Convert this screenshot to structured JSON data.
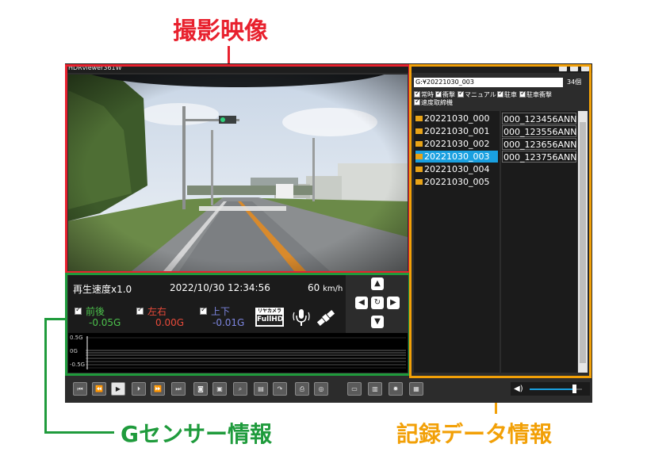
{
  "callouts": {
    "video": "撮影映像",
    "gsensor": "Gセンサー情報",
    "record": "記録データ情報"
  },
  "app": {
    "title": "HDRviewer361W"
  },
  "info": {
    "speed_label": "再生速度x1.0",
    "datetime": "2022/10/30 12:34:56",
    "speed_value": "60",
    "speed_unit": "km/h",
    "axes": [
      {
        "label": "前後",
        "value": "-0.05G",
        "color": "#4cc14c"
      },
      {
        "label": "左右",
        "value": "0.00G",
        "color": "#e84a3a"
      },
      {
        "label": "上下",
        "value": "-0.01G",
        "color": "#7d86e0"
      }
    ],
    "rear_camera_line1": "リヤカメラ",
    "rear_camera_line2": "FullHD"
  },
  "graph": {
    "top": "0.5G",
    "mid": "0G",
    "bottom": "-0.5G"
  },
  "right": {
    "path": "G:¥20221030_003",
    "count": "34個",
    "filters": [
      "常時",
      "衝撃",
      "マニュアル",
      "駐車",
      "駐車衝撃",
      "速度取締機"
    ],
    "folders": [
      "20221030_000",
      "20221030_001",
      "20221030_002",
      "20221030_003",
      "20221030_004",
      "20221030_005"
    ],
    "selected_folder_index": 3,
    "files": [
      "000_123456ANN",
      "000_123556ANN",
      "000_123656ANN",
      "000_123756ANN"
    ]
  },
  "colors": {
    "red": "#e8212e",
    "green": "#1f9b3c",
    "orange": "#f2a007",
    "selection": "#1aa0e0"
  },
  "icons": {
    "toolbar": [
      "skip-start-icon",
      "step-back-icon",
      "play-icon",
      "step-forward-icon",
      "fast-forward-icon",
      "skip-end-icon",
      "camera-icon",
      "video-capture-icon",
      "zoom-icon",
      "image-icon",
      "rotate-180-icon",
      "print-icon",
      "globe-icon",
      "folder-icon",
      "trash-icon",
      "gear-icon",
      "save-icon",
      "volume-icon"
    ]
  },
  "volume_level": 0.85
}
